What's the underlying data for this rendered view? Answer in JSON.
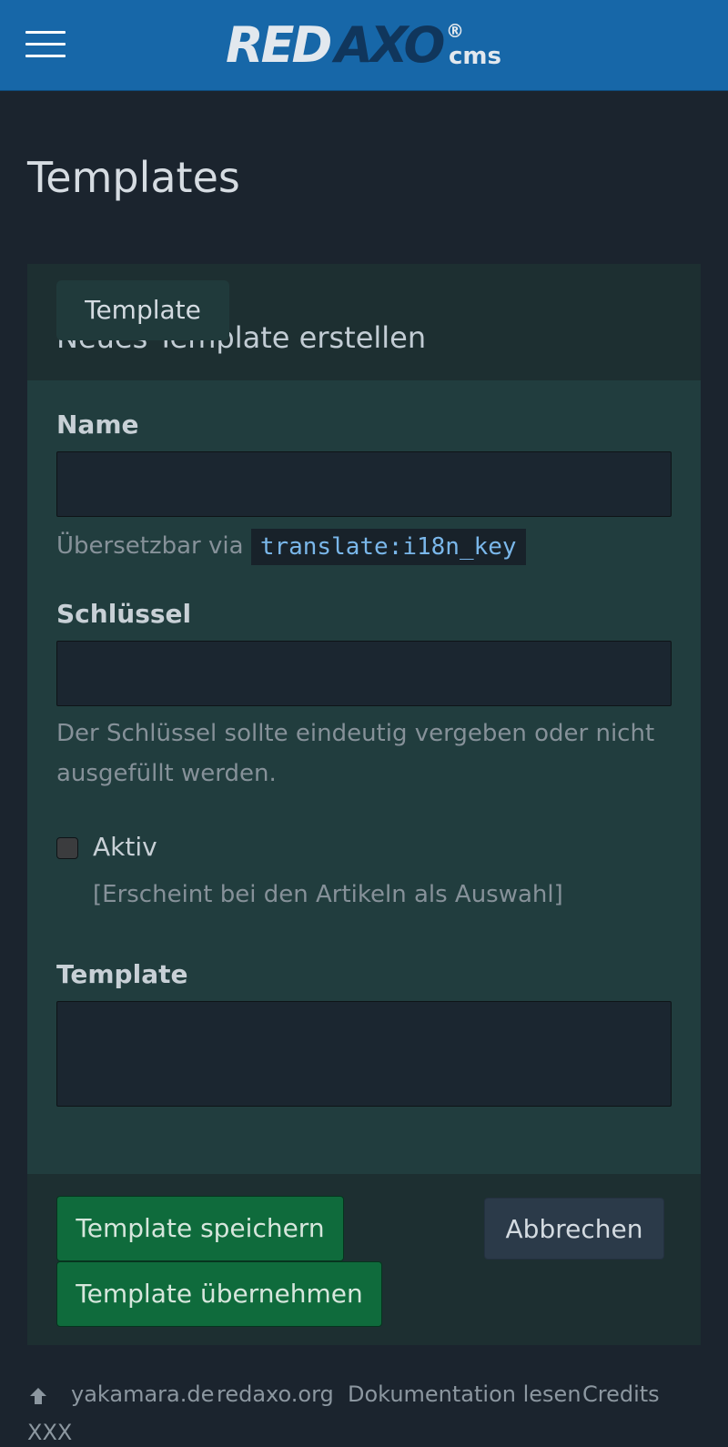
{
  "header": {
    "menu_icon": "hamburger-menu-icon",
    "logo_red": "RED",
    "logo_axo": "AXO",
    "logo_reg": "®",
    "logo_cms": "cms"
  },
  "page": {
    "title": "Templates"
  },
  "panel": {
    "tab_label": "Template",
    "heading": "Neues Template erstellen",
    "name_label": "Name",
    "name_value": "",
    "name_help_prefix": "Übersetzbar via",
    "name_help_code": "translate:i18n_key",
    "key_label": "Schlüssel",
    "key_value": "",
    "key_help": "Der Schlüssel sollte eindeutig vergeben oder nicht ausgefüllt werden.",
    "active_label": "Aktiv",
    "active_checked": false,
    "active_help": "[Erscheint bei den Artikeln als Auswahl]",
    "template_label": "Template",
    "template_value": "",
    "save_button": "Template speichern",
    "apply_button": "Template übernehmen",
    "cancel_button": "Abbrechen"
  },
  "colors": {
    "header_bg": "#1767a8",
    "page_bg": "#1b242e",
    "panel_bg": "#213d3e",
    "primary_button": "#0f6b3c",
    "code_text": "#7ab7ea"
  },
  "footer": {
    "up_icon": "arrow-up-icon",
    "links": [
      "yakamara.de",
      "redaxo.org",
      "Dokumentation lesen",
      "Credits"
    ],
    "extra": "XXX"
  }
}
